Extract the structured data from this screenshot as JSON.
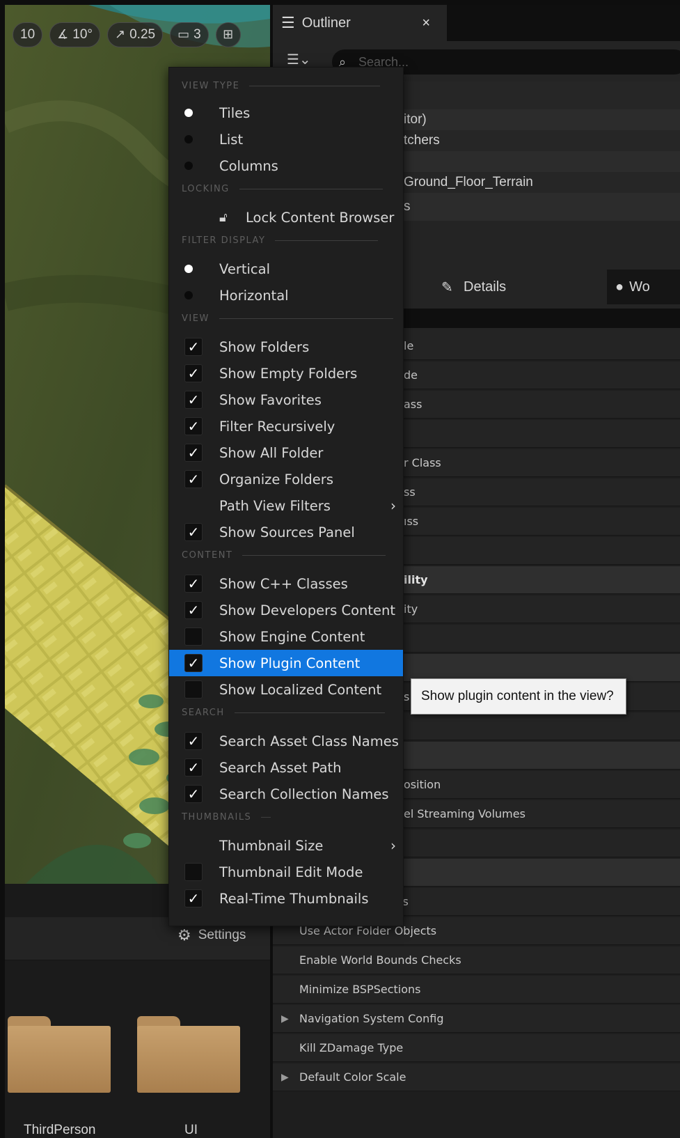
{
  "viewport_toolbar": {
    "grid_snap": "10",
    "rotation_snap": "10°",
    "scale_snap": "0.25",
    "camera_speed": "3"
  },
  "outliner": {
    "tab_label": "Outliner",
    "close_glyph": "×",
    "search_placeholder": "Search...",
    "rows": [
      "itor)",
      "tchers",
      "Ground_Floor_Terrain",
      "s"
    ]
  },
  "details": {
    "tab_label": "Details",
    "world_tab_label": "Wo",
    "rows": [
      {
        "text": "le",
        "kind": "row"
      },
      {
        "text": "de",
        "kind": "row"
      },
      {
        "text": "ass",
        "kind": "row"
      },
      {
        "text": "",
        "kind": "row"
      },
      {
        "text": "r Class",
        "kind": "row"
      },
      {
        "text": "ss",
        "kind": "row"
      },
      {
        "text": "ıss",
        "kind": "row"
      },
      {
        "text": "",
        "kind": "row"
      },
      {
        "text": "ility",
        "kind": "cat"
      },
      {
        "text": "ity",
        "kind": "row"
      },
      {
        "text": "",
        "kind": "row"
      },
      {
        "text": "",
        "kind": "cat"
      },
      {
        "text": "s",
        "kind": "row"
      },
      {
        "text": "",
        "kind": "row"
      },
      {
        "text": "",
        "kind": "cat"
      },
      {
        "text": "osition",
        "kind": "row"
      },
      {
        "text": "el Streaming Volumes",
        "kind": "row"
      },
      {
        "text": "",
        "kind": "row"
      },
      {
        "text": "",
        "kind": "cat"
      },
      {
        "text": "Use External Actors",
        "kind": "full"
      },
      {
        "text": "Use Actor Folder Objects",
        "kind": "full"
      },
      {
        "text": "Enable World Bounds Checks",
        "kind": "full"
      },
      {
        "text": "Minimize BSPSections",
        "kind": "full"
      },
      {
        "text": "Navigation System Config",
        "kind": "expand"
      },
      {
        "text": "Kill ZDamage Type",
        "kind": "full"
      },
      {
        "text": "Default Color Scale",
        "kind": "expand"
      }
    ]
  },
  "content_browser": {
    "settings_label": "Settings",
    "folders": [
      "ThirdPerson",
      "UI"
    ]
  },
  "menu": {
    "sections": {
      "view_type": "VIEW TYPE",
      "locking": "LOCKING",
      "filter_display": "FILTER DISPLAY",
      "view": "VIEW",
      "content": "CONTENT",
      "search": "SEARCH",
      "thumbnails": "THUMBNAILS"
    },
    "view_type": {
      "tiles": "Tiles",
      "list": "List",
      "columns": "Columns",
      "selected": "Tiles"
    },
    "locking": {
      "lock": "Lock Content Browser"
    },
    "filter_display": {
      "vertical": "Vertical",
      "horizontal": "Horizontal",
      "selected": "Vertical"
    },
    "view": {
      "show_folders": "Show Folders",
      "show_empty_folders": "Show Empty Folders",
      "show_favorites": "Show Favorites",
      "filter_recursively": "Filter Recursively",
      "show_all_folder": "Show All Folder",
      "organize_folders": "Organize Folders",
      "path_view_filters": "Path View Filters",
      "show_sources_panel": "Show Sources Panel"
    },
    "content": {
      "show_cpp": "Show C++ Classes",
      "show_developers": "Show Developers Content",
      "show_engine": "Show Engine Content",
      "show_plugin": "Show Plugin Content",
      "show_localized": "Show Localized Content"
    },
    "search": {
      "asset_class_names": "Search Asset Class Names",
      "asset_path": "Search Asset Path",
      "collection_names": "Search Collection Names"
    },
    "thumbnails": {
      "size": "Thumbnail Size",
      "edit_mode": "Thumbnail Edit Mode",
      "real_time": "Real-Time Thumbnails"
    },
    "checked": {
      "show_folders": true,
      "show_empty_folders": true,
      "show_favorites": true,
      "filter_recursively": true,
      "show_all_folder": true,
      "organize_folders": true,
      "show_sources_panel": true,
      "show_cpp": true,
      "show_developers": true,
      "show_engine": false,
      "show_plugin": true,
      "show_localized": false,
      "asset_class_names": true,
      "asset_path": true,
      "collection_names": true,
      "edit_mode": false,
      "real_time": true
    },
    "highlighted": "show_plugin"
  },
  "tooltip": {
    "text": "Show plugin content in the view?"
  },
  "colors": {
    "highlight": "#1177e0",
    "panel": "#1f1f1f",
    "folder": "#c7a06d"
  }
}
